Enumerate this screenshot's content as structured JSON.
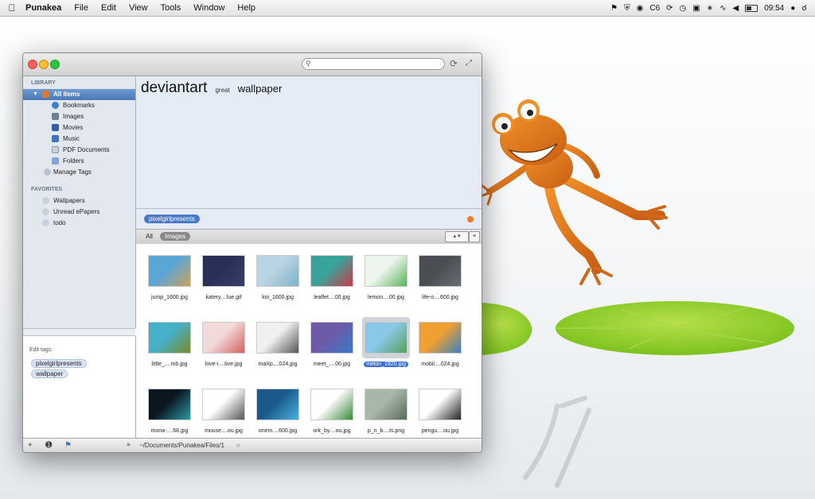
{
  "menubar": {
    "app_name": "Punakea",
    "menus": [
      "File",
      "Edit",
      "View",
      "Tools",
      "Window",
      "Help"
    ],
    "status_text": "C6",
    "clock": "09:54"
  },
  "window": {
    "search_placeholder": "",
    "sidebar": {
      "library_header": "LIBRARY",
      "items": [
        {
          "label": "All Items",
          "icon": "folder-icon",
          "color": "#e07a2a"
        },
        {
          "label": "Bookmarks",
          "icon": "globe-icon",
          "color": "#3f7fd0"
        },
        {
          "label": "Images",
          "icon": "image-icon",
          "color": "#6b7f95"
        },
        {
          "label": "Movies",
          "icon": "movie-icon",
          "color": "#2f5fa8"
        },
        {
          "label": "Music",
          "icon": "music-icon",
          "color": "#3d72c4"
        },
        {
          "label": "PDF Documents",
          "icon": "pdf-icon",
          "color": "#c9d2dc"
        },
        {
          "label": "Folders",
          "icon": "folder-icon",
          "color": "#7fa6d9"
        },
        {
          "label": "Manage Tags",
          "icon": "tags-icon",
          "color": "#b8c3cf"
        }
      ],
      "favorites_header": "FAVORITES",
      "favorites": [
        {
          "label": "Wallpapers"
        },
        {
          "label": "Unread ePapers"
        },
        {
          "label": "todo"
        }
      ]
    },
    "edit_tags": {
      "label": "Edit tags:",
      "tags": [
        "pixelgirlpresents",
        "wallpaper"
      ]
    },
    "notes": {
      "word1": "deviantart",
      "word2": "great",
      "word3": "wallpaper"
    },
    "active_tag": "pixelgirlpresents",
    "filter": {
      "all": "All",
      "images": "Images"
    },
    "files": [
      {
        "name": "jump_1600.jpg",
        "colors": [
          "#5aa6d6",
          "#c9a15b"
        ]
      },
      {
        "name": "katery....lue.gif",
        "colors": [
          "#2a2f5a",
          "#3a3f6a"
        ]
      },
      {
        "name": "koi_1600.jpg",
        "colors": [
          "#b9d4e2",
          "#7fb0c8"
        ]
      },
      {
        "name": "leaflet....00.jpg",
        "colors": [
          "#39a39a",
          "#c93a4a"
        ]
      },
      {
        "name": "lemon....00.jpg",
        "colors": [
          "#eef4ee",
          "#5ab35a"
        ]
      },
      {
        "name": "life-o....600.jpg",
        "colors": [
          "#4a4d52",
          "#6a6e75"
        ]
      },
      {
        "name": "little_....mb.jpg",
        "colors": [
          "#46b1c9",
          "#7a8a2a"
        ]
      },
      {
        "name": "love-i....tive.jpg",
        "colors": [
          "#f3dada",
          "#d06060"
        ]
      },
      {
        "name": "maXp....024.jpg",
        "colors": [
          "#f0f0f0",
          "#555"
        ]
      },
      {
        "name": "meet_....00.jpg",
        "colors": [
          "#6c5aa8",
          "#3a7ac8"
        ]
      },
      {
        "name": "melon_1920.jpg",
        "colors": [
          "#8ac8e8",
          "#5aa05a"
        ]
      },
      {
        "name": "mobil....024.jpg",
        "colors": [
          "#f0a030",
          "#3a80c0"
        ]
      },
      {
        "name": "mona-....68.jpg",
        "colors": [
          "#0a1620",
          "#2a9aa8"
        ]
      },
      {
        "name": "mouse....ou.jpg",
        "colors": [
          "#ffffff",
          "#555"
        ]
      },
      {
        "name": "onem....600.jpg",
        "colors": [
          "#1a5a8a",
          "#4ab0e0"
        ]
      },
      {
        "name": "ork_by....ou.jpg",
        "colors": [
          "#ffffff",
          "#3a8a3a"
        ]
      },
      {
        "name": "p_n_b....ts.png",
        "colors": [
          "#a8b8a8",
          "#5a6a5a"
        ]
      },
      {
        "name": "pengu....ou.jpg",
        "colors": [
          "#ffffff",
          "#222"
        ]
      }
    ],
    "selected_index": 10,
    "path": "~/Documents/Punakea/Files/1"
  }
}
